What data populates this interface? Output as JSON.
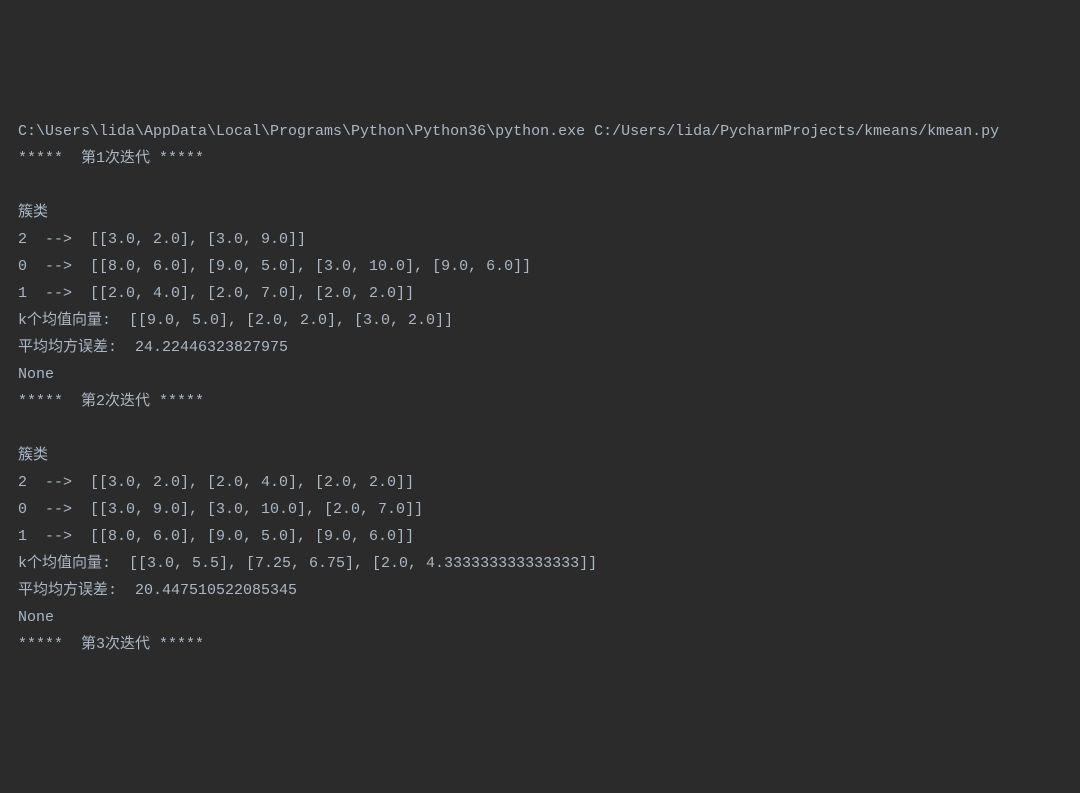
{
  "console": {
    "lines": [
      "C:\\Users\\lida\\AppData\\Local\\Programs\\Python\\Python36\\python.exe C:/Users/lida/PycharmProjects/kmeans/kmean.py",
      "*****  第1次迭代 *****",
      "",
      "簇类",
      "2  -->  [[3.0, 2.0], [3.0, 9.0]]",
      "0  -->  [[8.0, 6.0], [9.0, 5.0], [3.0, 10.0], [9.0, 6.0]]",
      "1  -->  [[2.0, 4.0], [2.0, 7.0], [2.0, 2.0]]",
      "k个均值向量:  [[9.0, 5.0], [2.0, 2.0], [3.0, 2.0]]",
      "平均均方误差:  24.22446323827975",
      "None",
      "*****  第2次迭代 *****",
      "",
      "簇类",
      "2  -->  [[3.0, 2.0], [2.0, 4.0], [2.0, 2.0]]",
      "0  -->  [[3.0, 9.0], [3.0, 10.0], [2.0, 7.0]]",
      "1  -->  [[8.0, 6.0], [9.0, 5.0], [9.0, 6.0]]",
      "k个均值向量:  [[3.0, 5.5], [7.25, 6.75], [2.0, 4.333333333333333]]",
      "平均均方误差:  20.447510522085345",
      "None",
      "*****  第3次迭代 *****"
    ]
  }
}
